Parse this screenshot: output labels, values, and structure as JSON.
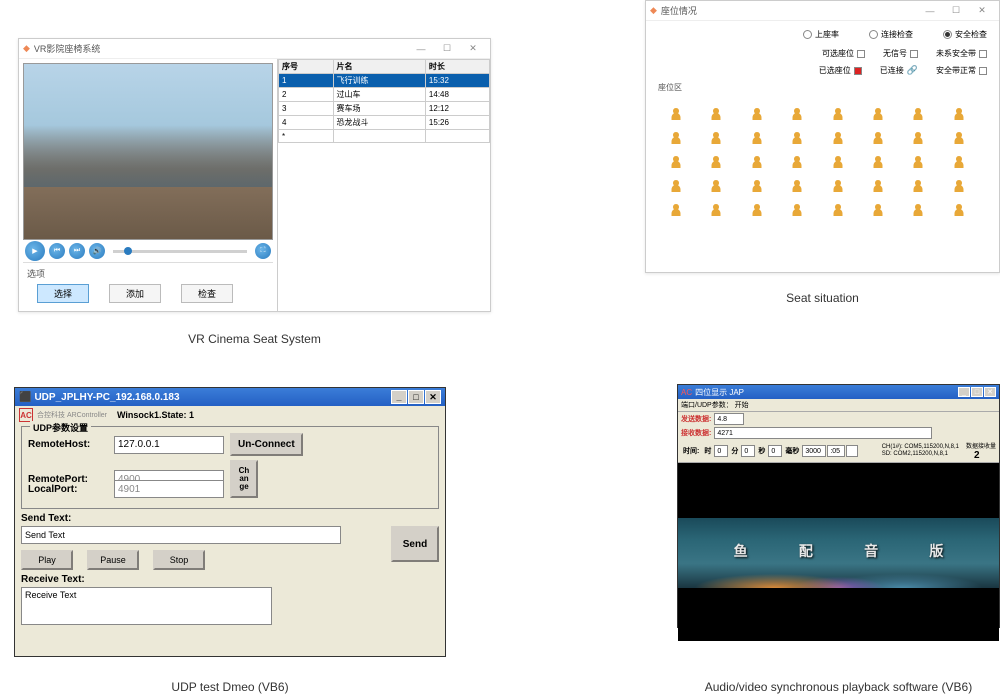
{
  "captions": {
    "vr": "VR Cinema Seat System",
    "seat": "Seat situation",
    "udp": "UDP test Dmeo (VB6)",
    "av": "Audio/video synchronous playback software (VB6)"
  },
  "vr": {
    "title": "VR影院座椅系统",
    "options_label": "选项",
    "buttons": {
      "select": "选择",
      "add": "添加",
      "check": "检查"
    },
    "table": {
      "headers": {
        "seq": "序号",
        "name": "片名",
        "duration": "时长"
      },
      "rows": [
        {
          "seq": "1",
          "name": "飞行训练",
          "duration": "15:32"
        },
        {
          "seq": "2",
          "name": "过山车",
          "duration": "14:48"
        },
        {
          "seq": "3",
          "name": "赛车场",
          "duration": "12:12"
        },
        {
          "seq": "4",
          "name": "恐龙战斗",
          "duration": "15:26"
        }
      ],
      "aster": "*"
    }
  },
  "seat": {
    "title": "座位情况",
    "radios": {
      "online": "上座率",
      "check_pos": "连接检查",
      "safety": "安全检查"
    },
    "legend1": {
      "noconn": "可选座位",
      "nosig": "无信号",
      "nobelt": "未系安全带"
    },
    "legend2": {
      "selected": "已选座位",
      "connected": "已连接",
      "belt_ok": "安全带正常"
    },
    "area_label": "座位区"
  },
  "udp": {
    "title": "UDP_JPLHY-PC_192.168.0.183",
    "logo_text": "合控科技 ARController",
    "status": "Winsock1.State:  1",
    "fieldset_legend": "UDP参数设置",
    "labels": {
      "rhost": "RemoteHost:",
      "rport": "RemotePort:",
      "lport": "LocalPort:"
    },
    "values": {
      "rhost": "127.0.0.1",
      "rport": "4900",
      "lport": "4901"
    },
    "buttons": {
      "unconnect": "Un-Connect",
      "change": "Ch\nan\nge",
      "play": "Play",
      "pause": "Pause",
      "stop": "Stop",
      "send": "Send"
    },
    "send_label": "Send Text:",
    "send_value": "Send Text",
    "recv_label": "Receive Text:",
    "recv_value": "Receive Text"
  },
  "av": {
    "title": "四位显示 JAP",
    "toolbar": "端口/UDP参数：     开始",
    "send_label": "发送数据:",
    "send_val": "4.8",
    "recv_label": "接收数据:",
    "recv_val": "4271",
    "time_label": "时间:",
    "time": {
      "h_lbl": "时",
      "h": "0",
      "m_lbl": "分",
      "m": "0",
      "s_lbl": "秒",
      "s": "0",
      "ms_lbl": "毫秒",
      "ms": "3000",
      "gap": ":05"
    },
    "info": {
      "ch1": "CH(1#): COM5,115200,N,8,1",
      "sd": "SD: COM2,115200,N,8,1"
    },
    "count_lbl": "数据接收量",
    "count_val": "2",
    "chars": {
      "c1": "鱼",
      "c2": "配",
      "c3": "音",
      "c4": "版"
    }
  }
}
